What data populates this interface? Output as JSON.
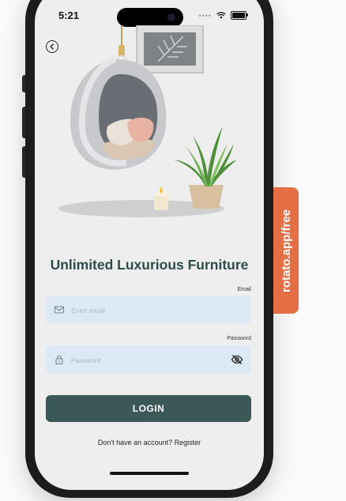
{
  "status_bar": {
    "time": "5:21"
  },
  "title": "Unlimited Luxurious Furniture",
  "email": {
    "label": "Email",
    "placeholder": "Enter email"
  },
  "password": {
    "label": "Password",
    "placeholder": "Password"
  },
  "login_label": "LOGIN",
  "register_text": "Don't have an account? Register",
  "promo": "rotato.app/free",
  "colors": {
    "accent": "#3b5757",
    "title": "#2f4a4a",
    "input_bg": "#dde9f5",
    "promo_bg": "#e46f44",
    "screen_bg": "#eeeeee"
  },
  "icons": [
    "back-arrow-icon",
    "mail-icon",
    "lock-icon",
    "eye-off-icon",
    "wifi-icon",
    "battery-icon"
  ]
}
